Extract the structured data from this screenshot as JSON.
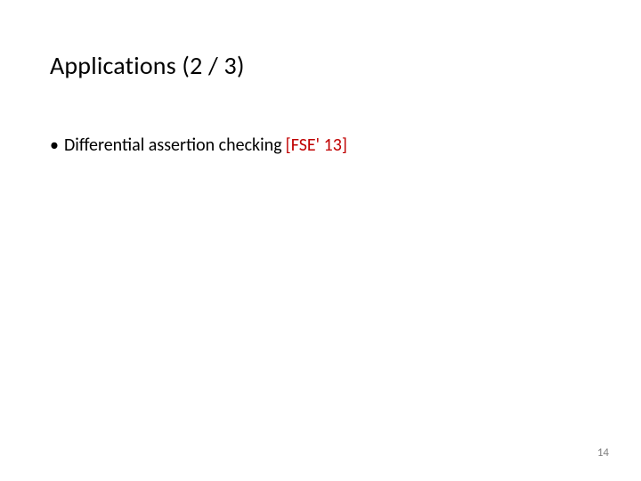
{
  "slide": {
    "title": "Applications (2 / 3)",
    "bullets": [
      {
        "text": "Differential assertion checking",
        "citation": "[FSE' 13]"
      }
    ],
    "page_number": "14"
  }
}
